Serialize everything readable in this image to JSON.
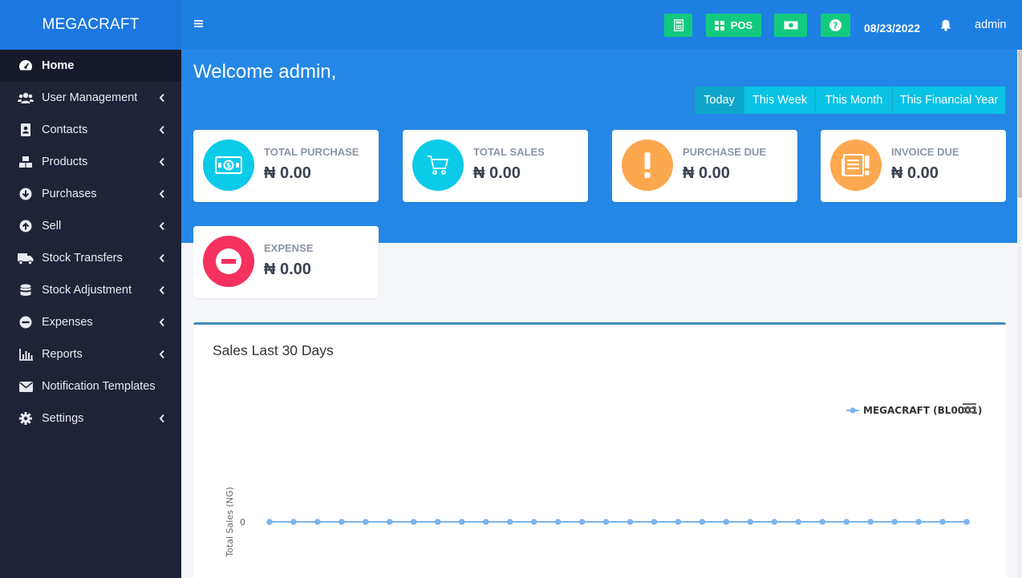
{
  "brand": "MEGACRAFT",
  "sidebar": {
    "items": [
      {
        "label": "Home",
        "icon": "dashboard-icon"
      },
      {
        "label": "User Management",
        "icon": "users-icon"
      },
      {
        "label": "Contacts",
        "icon": "address-book-icon"
      },
      {
        "label": "Products",
        "icon": "cubes-icon"
      },
      {
        "label": "Purchases",
        "icon": "arrow-circle-down-icon"
      },
      {
        "label": "Sell",
        "icon": "arrow-circle-up-icon"
      },
      {
        "label": "Stock Transfers",
        "icon": "truck-icon"
      },
      {
        "label": "Stock Adjustment",
        "icon": "database-icon"
      },
      {
        "label": "Expenses",
        "icon": "minus-circle-icon"
      },
      {
        "label": "Reports",
        "icon": "bar-chart-icon"
      },
      {
        "label": "Notification Templates",
        "icon": "envelope-icon"
      },
      {
        "label": "Settings",
        "icon": "gear-icon"
      }
    ]
  },
  "header": {
    "pos_label": "POS",
    "date": "08/23/2022",
    "user": "admin"
  },
  "welcome": "Welcome admin,",
  "date_ranges": [
    "Today",
    "This Week",
    "This Month",
    "This Financial Year"
  ],
  "stats": [
    {
      "label": "TOTAL PURCHASE",
      "value": "₦ 0.00",
      "color": "#0ccbe8",
      "icon": "money-icon"
    },
    {
      "label": "TOTAL SALES",
      "value": "₦ 0.00",
      "color": "#0ccbe8",
      "icon": "cart-icon"
    },
    {
      "label": "PURCHASE DUE",
      "value": "₦ 0.00",
      "color": "#fca84f",
      "icon": "exclamation-icon"
    },
    {
      "label": "INVOICE DUE",
      "value": "₦ 0.00",
      "color": "#fca84f",
      "icon": "invoice-icon"
    },
    {
      "label": "EXPENSE",
      "value": "₦ 0.00",
      "color": "#f5325e",
      "icon": "minus-circle-icon"
    }
  ],
  "chart_panel": {
    "title": "Sales Last 30 Days"
  },
  "chart_data": {
    "type": "line",
    "title": "",
    "xlabel": "",
    "ylabel": "Total Sales (NG)",
    "yticks": [
      "0"
    ],
    "series": [
      {
        "name": "MEGACRAFT (BL0001)",
        "values": [
          0,
          0,
          0,
          0,
          0,
          0,
          0,
          0,
          0,
          0,
          0,
          0,
          0,
          0,
          0,
          0,
          0,
          0,
          0,
          0,
          0,
          0,
          0,
          0,
          0,
          0,
          0,
          0,
          0,
          0
        ]
      }
    ],
    "series_color": "#7cb5ec",
    "legend": "top-right",
    "grid": false
  }
}
